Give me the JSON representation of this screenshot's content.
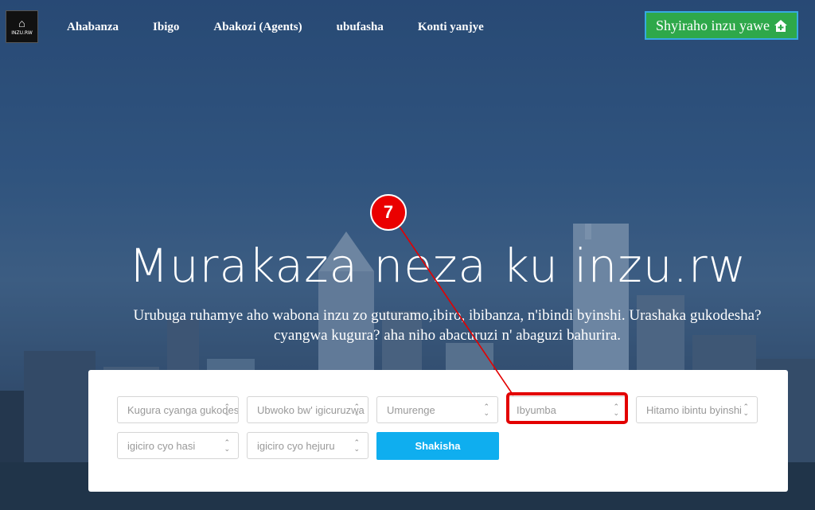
{
  "brand": {
    "logo_text": "INZU.RW"
  },
  "nav": {
    "items": [
      "Ahabanza",
      "Ibigo",
      "Abakozi (Agents)",
      "ubufasha",
      "Konti yanjye"
    ]
  },
  "cta": {
    "label": "Shyiraho inzu yawe"
  },
  "hero": {
    "title": "Murakaza neza ku inzu.rw",
    "subtitle_line1": "Urubuga ruhamye aho wabona inzu zo guturamo,ibiro, ibibanza, n'ibindi byinshi. Urashaka gukodesha?",
    "subtitle_line2": "cyangwa kugura? aha niho abacuruzi n' abaguzi bahurira."
  },
  "search": {
    "fields": [
      "Kugura cyanga gukodesha",
      "Ubwoko bw' igicuruzwa",
      "Umurenge",
      "Ibyumba",
      "Hitamo ibintu byinshi",
      "igiciro cyo hasi",
      "igiciro cyo hejuru"
    ],
    "button": "Shakisha"
  },
  "annotation": {
    "step": "7",
    "color": "#e30000"
  }
}
